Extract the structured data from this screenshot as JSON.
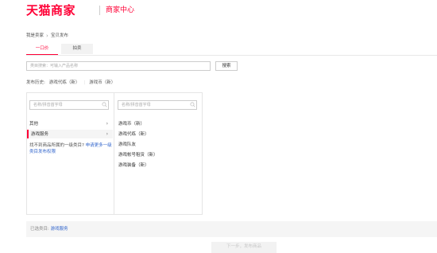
{
  "header": {
    "brand": "天猫商家",
    "subtitle": "商家中心",
    "brand_color": "#ff0036"
  },
  "breadcrumb": {
    "home": "我是卖家",
    "current": "宝贝发布"
  },
  "tabs": [
    {
      "label": "一口价",
      "active": true
    },
    {
      "label": "拍卖",
      "active": false
    }
  ],
  "search": {
    "placeholder": "类目搜索：可输入产品名称",
    "button": "搜索"
  },
  "history": {
    "label": "发布历史:",
    "items": [
      "游戏代练（新）",
      "游戏币（新）"
    ]
  },
  "category_panel": {
    "left": {
      "search_placeholder": "名称/拼音首字母",
      "items": [
        {
          "label": "其他",
          "selected": false
        },
        {
          "label": "游戏服务",
          "selected": true
        }
      ],
      "not_found_text": "找不到商品所属的一级类目?",
      "not_found_link": "申请更多一级类目发布权限"
    },
    "right": {
      "search_placeholder": "名称/拼音首字母",
      "items": [
        "游戏币（新）",
        "游戏代练（新）",
        "游戏队友",
        "游戏帐号租赁（新）",
        "游戏装备（新）"
      ]
    }
  },
  "selected": {
    "label": "已选类目:",
    "value": "游戏服务"
  },
  "next_button": "下一步，发布商品",
  "icons": {
    "search": "search-icon",
    "arrow": "chevron-right-icon"
  }
}
